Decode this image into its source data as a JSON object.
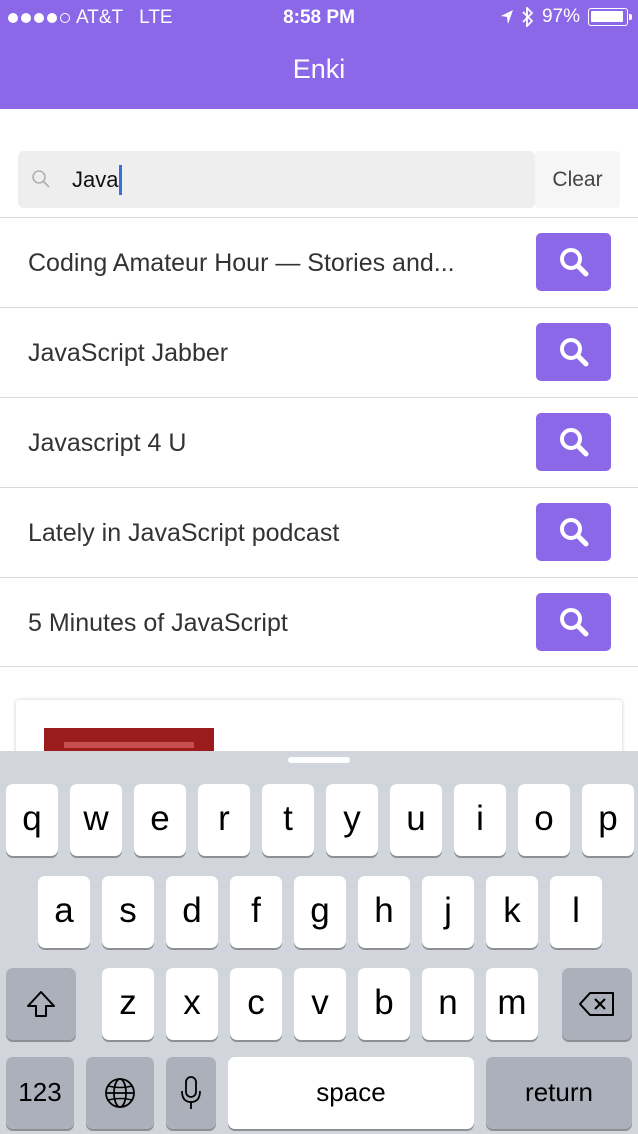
{
  "status": {
    "carrier": "AT&T",
    "network": "LTE",
    "time": "8:58 PM",
    "battery": "97%",
    "battery_level": 0.97
  },
  "header": {
    "title": "Enki"
  },
  "search": {
    "value": "Java",
    "clear_label": "Clear"
  },
  "results": [
    {
      "label": "Coding Amateur Hour — Stories and..."
    },
    {
      "label": "JavaScript Jabber"
    },
    {
      "label": "Javascript 4 U"
    },
    {
      "label": "Lately in JavaScript podcast"
    },
    {
      "label": "5 Minutes of JavaScript"
    }
  ],
  "keyboard": {
    "row1": [
      "q",
      "w",
      "e",
      "r",
      "t",
      "y",
      "u",
      "i",
      "o",
      "p"
    ],
    "row2": [
      "a",
      "s",
      "d",
      "f",
      "g",
      "h",
      "j",
      "k",
      "l"
    ],
    "row3": [
      "z",
      "x",
      "c",
      "v",
      "b",
      "n",
      "m"
    ],
    "numbers_label": "123",
    "space_label": "space",
    "return_label": "return"
  },
  "colors": {
    "accent": "#8b68e8"
  },
  "icons": [
    "location-arrow-icon",
    "bluetooth-icon",
    "battery-icon",
    "search-icon",
    "shift-icon",
    "delete-icon",
    "globe-icon",
    "microphone-icon"
  ]
}
